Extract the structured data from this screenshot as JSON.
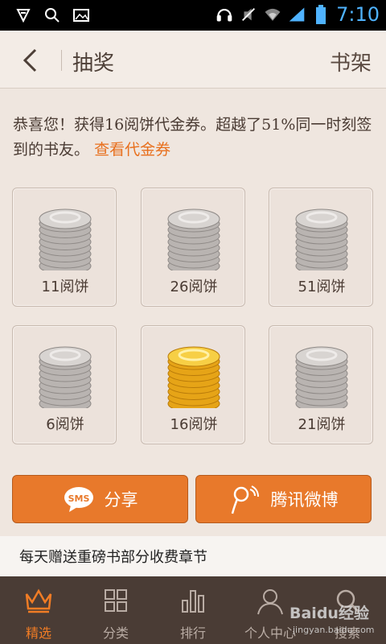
{
  "status_bar": {
    "time": "7:10"
  },
  "header": {
    "title": "抽奖",
    "shelf_label": "书架"
  },
  "message": {
    "text": "恭喜您！获得16阅饼代金券。超越了51%同一时刻签到的书友。",
    "link": "查看代金券"
  },
  "prizes": [
    {
      "label": "11阅饼",
      "gold": false
    },
    {
      "label": "26阅饼",
      "gold": false
    },
    {
      "label": "51阅饼",
      "gold": false
    },
    {
      "label": "6阅饼",
      "gold": false
    },
    {
      "label": "16阅饼",
      "gold": true
    },
    {
      "label": "21阅饼",
      "gold": false
    }
  ],
  "buttons": {
    "share_label": "分享",
    "sms_badge": "SMS",
    "weibo_label": "腾讯微博"
  },
  "banner": {
    "text": "每天赠送重磅书部分收费章节"
  },
  "tabs": [
    {
      "label": "精选",
      "icon": "crown-icon",
      "active": true
    },
    {
      "label": "分类",
      "icon": "grid-icon",
      "active": false
    },
    {
      "label": "排行",
      "icon": "bar-chart-icon",
      "active": false
    },
    {
      "label": "个人中心",
      "icon": "user-icon",
      "active": false
    },
    {
      "label": "搜索",
      "icon": "search-icon",
      "active": false
    }
  ],
  "watermark": {
    "text": "Baidu经验",
    "url": "jingyan.baidu.com"
  },
  "colors": {
    "accent": "#e8792b",
    "tab_bg": "#4a3c35",
    "active_tab": "#f07c25",
    "time": "#4fb3ff"
  }
}
